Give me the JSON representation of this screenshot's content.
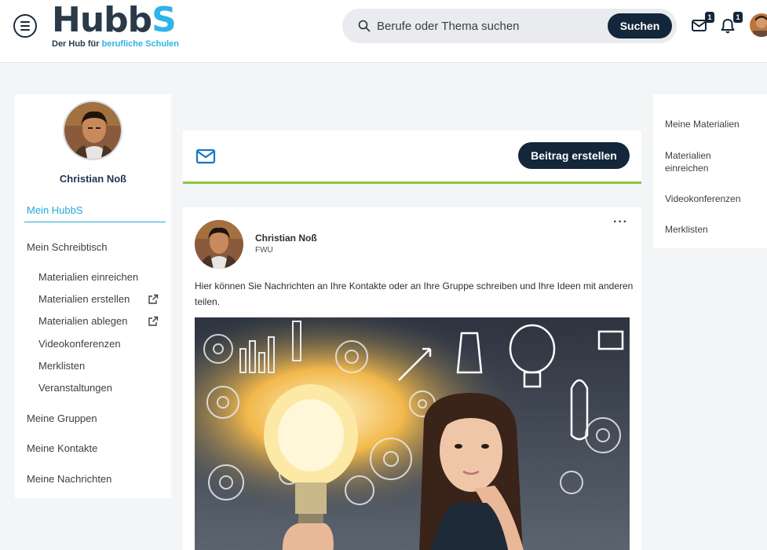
{
  "header": {
    "logo": {
      "part_dark": "Hubb",
      "part_blue": "S",
      "tagline_dark": "Der Hub für ",
      "tagline_blue": "berufliche Schulen"
    },
    "search": {
      "placeholder": "Berufe oder Thema suchen",
      "button_label": "Suchen"
    },
    "mail_badge": "1",
    "notification_badge": "1"
  },
  "profile": {
    "name": "Christian Noß"
  },
  "sidebar": {
    "active_item": "Mein HubbS",
    "items": [
      "Mein Schreibtisch",
      "Meine Gruppen",
      "Meine Kontakte",
      "Meine Nachrichten"
    ],
    "sub_items": [
      "Materialien einreichen",
      "Materialien erstellen",
      "Materialien ablegen",
      "Videokonferenzen",
      "Merklisten",
      "Veranstaltungen"
    ]
  },
  "composer": {
    "create_button_label": "Beitrag erstellen"
  },
  "post": {
    "author": "Christian Noß",
    "org": "FWU",
    "more": "···",
    "text": "Hier können Sie Nachrichten an Ihre Kontakte oder an Ihre Gruppe schreiben und Ihre Ideen mit anderen teilen."
  },
  "right_menu": {
    "items": [
      "Meine Materialien",
      "Materialien einreichen",
      "Videokonferenzen",
      "Merklisten"
    ]
  },
  "colors": {
    "navy": "#13263a",
    "accent_blue": "#23a9dc",
    "accent_green": "#8dc63f"
  }
}
